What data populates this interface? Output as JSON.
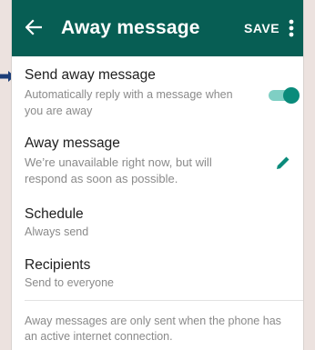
{
  "colors": {
    "appbar": "#075e54",
    "accent": "#0a8b7b",
    "accent_light": "#7fcfc4",
    "pointer": "#1b3d78",
    "background": "#ece2df"
  },
  "appbar": {
    "back_icon": "arrow-left-icon",
    "title": "Away message",
    "save_label": "SAVE",
    "more_icon": "more-vert-icon"
  },
  "settings": {
    "send_away": {
      "title": "Send away message",
      "subtitle_line1": "Automatically reply with a message when",
      "subtitle_line2": "you are away",
      "toggle_on": true
    },
    "away_message": {
      "title": "Away message",
      "text_line1": "We’re unavailable right now, but will",
      "text_line2": "respond as soon as possible.",
      "edit_icon": "pencil-icon"
    },
    "schedule": {
      "title": "Schedule",
      "value": "Always send"
    },
    "recipients": {
      "title": "Recipients",
      "value": "Send to everyone"
    }
  },
  "footer": {
    "note_line1": "Away messages are only sent when the phone has",
    "note_line2": "an active internet connection."
  }
}
